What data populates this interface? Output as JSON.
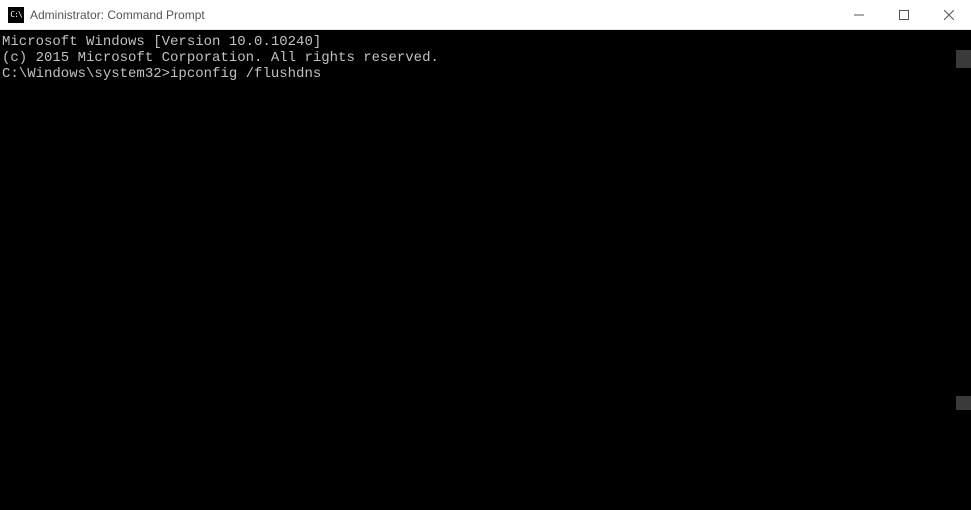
{
  "window": {
    "title": "Administrator: Command Prompt",
    "icon_glyph": "C:\\"
  },
  "console": {
    "line1": "Microsoft Windows [Version 10.0.10240]",
    "line2": "(c) 2015 Microsoft Corporation. All rights reserved.",
    "blank": "",
    "prompt": "C:\\Windows\\system32>",
    "command": "ipconfig /flushdns"
  }
}
